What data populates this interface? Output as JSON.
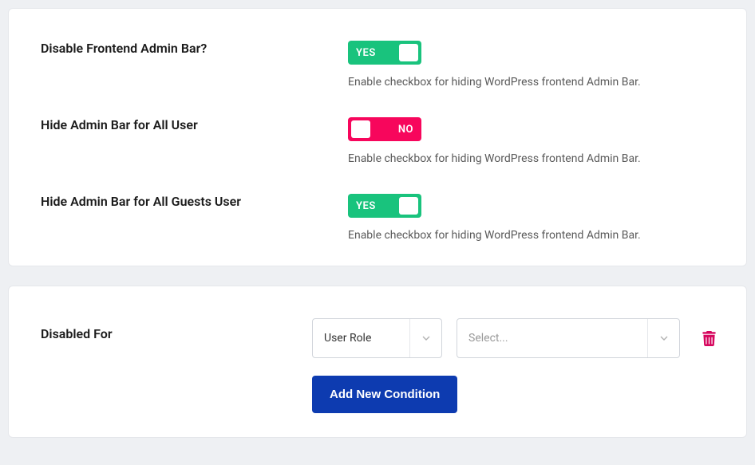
{
  "settings": [
    {
      "label": "Disable Frontend Admin Bar?",
      "state": "on",
      "yes_text": "YES",
      "no_text": "NO",
      "helper": "Enable checkbox for hiding WordPress frontend Admin Bar."
    },
    {
      "label": "Hide Admin Bar for All User",
      "state": "off",
      "yes_text": "YES",
      "no_text": "NO",
      "helper": "Enable checkbox for hiding WordPress frontend Admin Bar."
    },
    {
      "label": "Hide Admin Bar for All Guests User",
      "state": "on",
      "yes_text": "YES",
      "no_text": "NO",
      "helper": "Enable checkbox for hiding WordPress frontend Admin Bar."
    }
  ],
  "condition": {
    "label": "Disabled For",
    "select1_value": "User Role",
    "select2_placeholder": "Select...",
    "add_button": "Add New Condition"
  }
}
